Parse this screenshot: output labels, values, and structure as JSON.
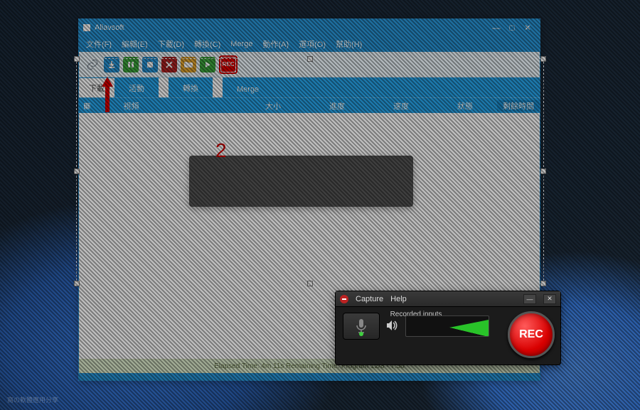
{
  "app": {
    "title": "Allavsoft",
    "menu": [
      "文件(F)",
      "編輯(E)",
      "下載(D)",
      "轉換(C)",
      "Merge",
      "動作(A)",
      "選項(O)",
      "幫助(H)"
    ]
  },
  "toolbar": {
    "rec_label": "REC"
  },
  "tabs": {
    "t0": "下載",
    "t1": "活動",
    "t2": "轉換",
    "t3": "Merge"
  },
  "headers": {
    "c1": "視頻",
    "c2": "大小",
    "c3": "進度",
    "c4": "速度",
    "c5": "狀態",
    "c6": "剩餘時間"
  },
  "annotation": {
    "number": "2"
  },
  "status": {
    "text": "Elapsed Time: 4m 11s Remaining Time: Program 12/8 - 7:50"
  },
  "capture": {
    "menu": [
      "Capture",
      "Help"
    ],
    "label": "Recorded inputs",
    "rec": "REC"
  },
  "watermark": "窩の軟體應用分享"
}
